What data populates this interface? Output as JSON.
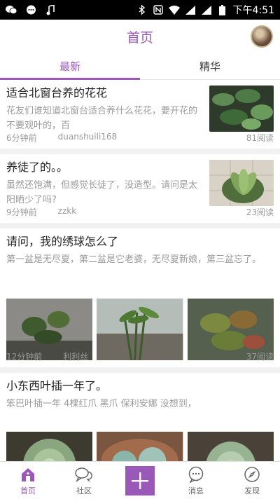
{
  "status_bar": {
    "time": "下午4:51"
  },
  "header": {
    "title": "首页"
  },
  "tabs": [
    {
      "label": "最新",
      "active": true
    },
    {
      "label": "精华",
      "active": false
    }
  ],
  "posts": [
    {
      "title": "适合北窗台养的花花",
      "summary": "花友们谁知道北窗台适合养什么花花，要开花的不要观叶的，百",
      "time": "6分钟前",
      "user": "duanshuili168",
      "reads": "81阅读"
    },
    {
      "title": "养徒了的。。",
      "summary": "虽然还饱满，但感觉长徒了，没造型。请问是太阳晒少了吗?",
      "time": "9分钟前",
      "user": "zzkk",
      "reads": "23阅读"
    },
    {
      "title": "请问，我的绣球怎么了",
      "summary": "第一盆是无尽夏，第二盆是它老婆，无尽夏新娘，第三盆忘了。",
      "time": "12分钟前",
      "user": "利利丝",
      "reads": "37阅读"
    },
    {
      "title": "小东西叶插一年了。",
      "summary": "笨巴叶插一年 4棵红爪 黑爪 保利安娜 没想到，",
      "time": "",
      "user": "",
      "reads": ""
    }
  ],
  "bottom_nav": [
    {
      "label": "首页",
      "icon": "home-icon",
      "active": true
    },
    {
      "label": "社区",
      "icon": "chat-bubbles-icon",
      "active": false
    },
    {
      "label": "",
      "icon": "plus-icon",
      "active": false
    },
    {
      "label": "消息",
      "icon": "message-icon",
      "active": false
    },
    {
      "label": "发现",
      "icon": "compass-icon",
      "active": false
    }
  ],
  "colors": {
    "accent": "#9a58b8",
    "muted": "#9a9a9a",
    "divider": "#f1f1f1"
  }
}
